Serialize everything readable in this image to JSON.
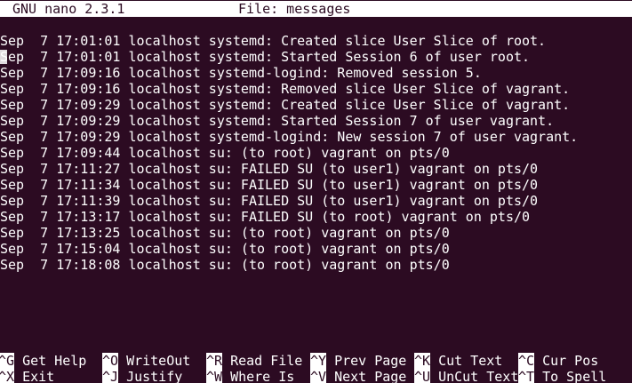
{
  "titlebar": {
    "app": "GNU nano 2.3.1",
    "file": "File: messages"
  },
  "lines": [
    "Sep  7 17:01:01 localhost systemd: Created slice User Slice of root.",
    "Sep  7 17:01:01 localhost systemd: Started Session 6 of user root.",
    "Sep  7 17:09:16 localhost systemd-logind: Removed session 5.",
    "Sep  7 17:09:16 localhost systemd: Removed slice User Slice of vagrant.",
    "Sep  7 17:09:29 localhost systemd: Created slice User Slice of vagrant.",
    "Sep  7 17:09:29 localhost systemd: Started Session 7 of user vagrant.",
    "Sep  7 17:09:29 localhost systemd-logind: New session 7 of user vagrant.",
    "Sep  7 17:09:44 localhost su: (to root) vagrant on pts/0",
    "Sep  7 17:11:27 localhost su: FAILED SU (to user1) vagrant on pts/0",
    "Sep  7 17:11:34 localhost su: FAILED SU (to user1) vagrant on pts/0",
    "Sep  7 17:11:39 localhost su: FAILED SU (to user1) vagrant on pts/0",
    "Sep  7 17:13:17 localhost su: FAILED SU (to root) vagrant on pts/0",
    "Sep  7 17:13:25 localhost su: (to root) vagrant on pts/0",
    "Sep  7 17:15:04 localhost su: (to root) vagrant on pts/0",
    "Sep  7 17:18:08 localhost su: (to root) vagrant on pts/0"
  ],
  "shortcuts": {
    "row1": [
      {
        "key": "^G",
        "label": "Get Help"
      },
      {
        "key": "^O",
        "label": "WriteOut"
      },
      {
        "key": "^R",
        "label": "Read File"
      },
      {
        "key": "^Y",
        "label": "Prev Page"
      },
      {
        "key": "^K",
        "label": "Cut Text"
      },
      {
        "key": "^C",
        "label": "Cur Pos"
      }
    ],
    "row2": [
      {
        "key": "^X",
        "label": "Exit"
      },
      {
        "key": "^J",
        "label": "Justify"
      },
      {
        "key": "^W",
        "label": "Where Is"
      },
      {
        "key": "^V",
        "label": "Next Page"
      },
      {
        "key": "^U",
        "label": "UnCut Text"
      },
      {
        "key": "^T",
        "label": "To Spell"
      }
    ]
  }
}
